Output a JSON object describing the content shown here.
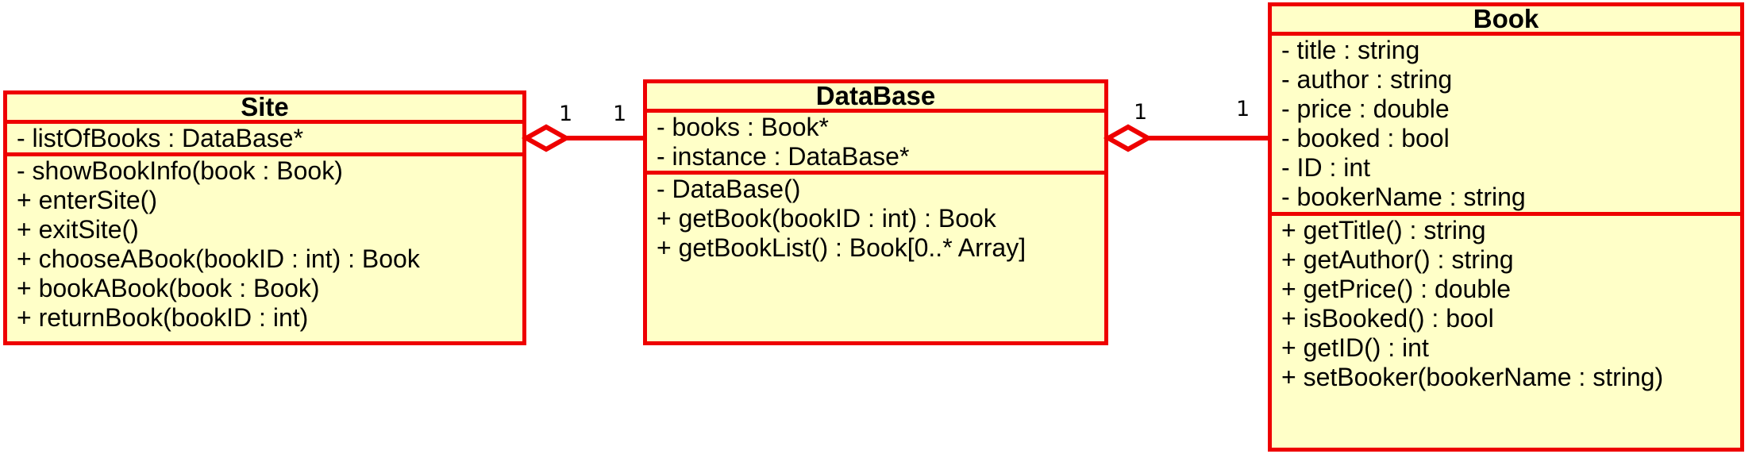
{
  "classes": {
    "site": {
      "name": "Site",
      "attributes": [
        "- listOfBooks : DataBase*"
      ],
      "operations": [
        "- showBookInfo(book : Book)",
        "+ enterSite()",
        "+ exitSite()",
        "+ chooseABook(bookID : int) : Book",
        "+ bookABook(book : Book)",
        "+ returnBook(bookID : int)"
      ]
    },
    "database": {
      "name": "DataBase",
      "attributes": [
        "- books : Book*",
        "- instance : DataBase*"
      ],
      "operations": [
        "- DataBase()",
        "+ getBook(bookID : int) : Book",
        "+ getBookList() : Book[0..* Array]"
      ]
    },
    "book": {
      "name": "Book",
      "attributes": [
        "- title : string",
        "- author : string",
        "- price : double",
        "- booked : bool",
        "- ID : int",
        "- bookerName : string"
      ],
      "operations": [
        "+ getTitle() : string",
        "+ getAuthor() : string",
        "+ getPrice() : double",
        "+ isBooked() : bool",
        "+ getID() : int",
        "+ setBooker(bookerName : string)"
      ]
    }
  },
  "associations": {
    "site_database": {
      "whole_multiplicity": "1",
      "part_multiplicity": "1"
    },
    "database_book": {
      "whole_multiplicity": "1",
      "part_multiplicity": "1"
    }
  },
  "colors": {
    "border": "#ee0000",
    "fill": "#ffffc8",
    "text": "#000000"
  }
}
